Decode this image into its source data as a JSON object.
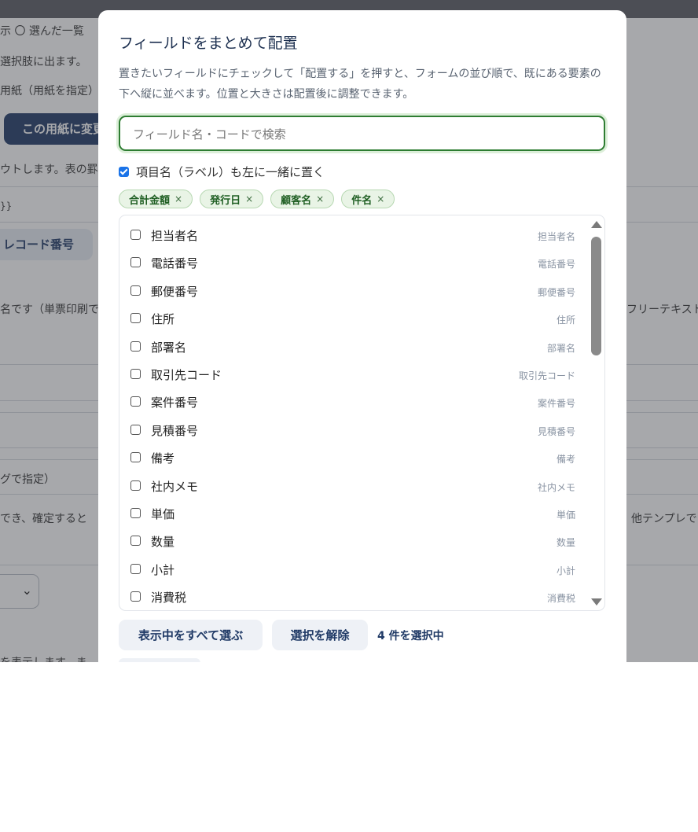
{
  "background": {
    "row1": "示 〇 選んだ一覧",
    "row2": "選択肢に出ます。",
    "row3": "用紙（用紙を指定）",
    "primary_button": "この用紙に変更",
    "row4": "ウトします。表の罫",
    "template_token": "}}",
    "chip": "レコード番号",
    "row5": "名です（単票印刷で",
    "row5_right": "フリーテキスト",
    "row6": "グで指定）",
    "row7": "でき、確定すると",
    "row7_right": "他テンプレで",
    "row8": "を表示します。ま"
  },
  "modal": {
    "title": "フィールドをまとめて配置",
    "description": "置きたいフィールドにチェックして「配置する」を押すと、フォームの並び順で、既にある要素の下へ縦に並べます。位置と大きさは配置後に調整できます。",
    "search_placeholder": "フィールド名・コードで検索",
    "search_value": "",
    "label_option": "項目名（ラベル）も左に一緒に置く",
    "label_option_checked": true,
    "selected_chips": [
      {
        "label": "合計金額",
        "remove": "×"
      },
      {
        "label": "発行日",
        "remove": "×"
      },
      {
        "label": "顧客名",
        "remove": "×"
      },
      {
        "label": "件名",
        "remove": "×"
      }
    ],
    "fields": [
      {
        "name": "担当者名",
        "code": "担当者名"
      },
      {
        "name": "電話番号",
        "code": "電話番号"
      },
      {
        "name": "郵便番号",
        "code": "郵便番号"
      },
      {
        "name": "住所",
        "code": "住所"
      },
      {
        "name": "部署名",
        "code": "部署名"
      },
      {
        "name": "取引先コード",
        "code": "取引先コード"
      },
      {
        "name": "案件番号",
        "code": "案件番号"
      },
      {
        "name": "見積番号",
        "code": "見積番号"
      },
      {
        "name": "備考",
        "code": "備考"
      },
      {
        "name": "社内メモ",
        "code": "社内メモ"
      },
      {
        "name": "単価",
        "code": "単価"
      },
      {
        "name": "数量",
        "code": "数量"
      },
      {
        "name": "小計",
        "code": "小計"
      },
      {
        "name": "消費税",
        "code": "消費税"
      }
    ],
    "select_all_label": "表示中をすべて選ぶ",
    "clear_label": "選択を解除",
    "selected_count": "4 件を選択中"
  },
  "colors": {
    "accent": "#1a73e8",
    "primary_dark": "#203a66",
    "chip_green": "#1e5e22",
    "focus_green": "#2e7d32"
  }
}
